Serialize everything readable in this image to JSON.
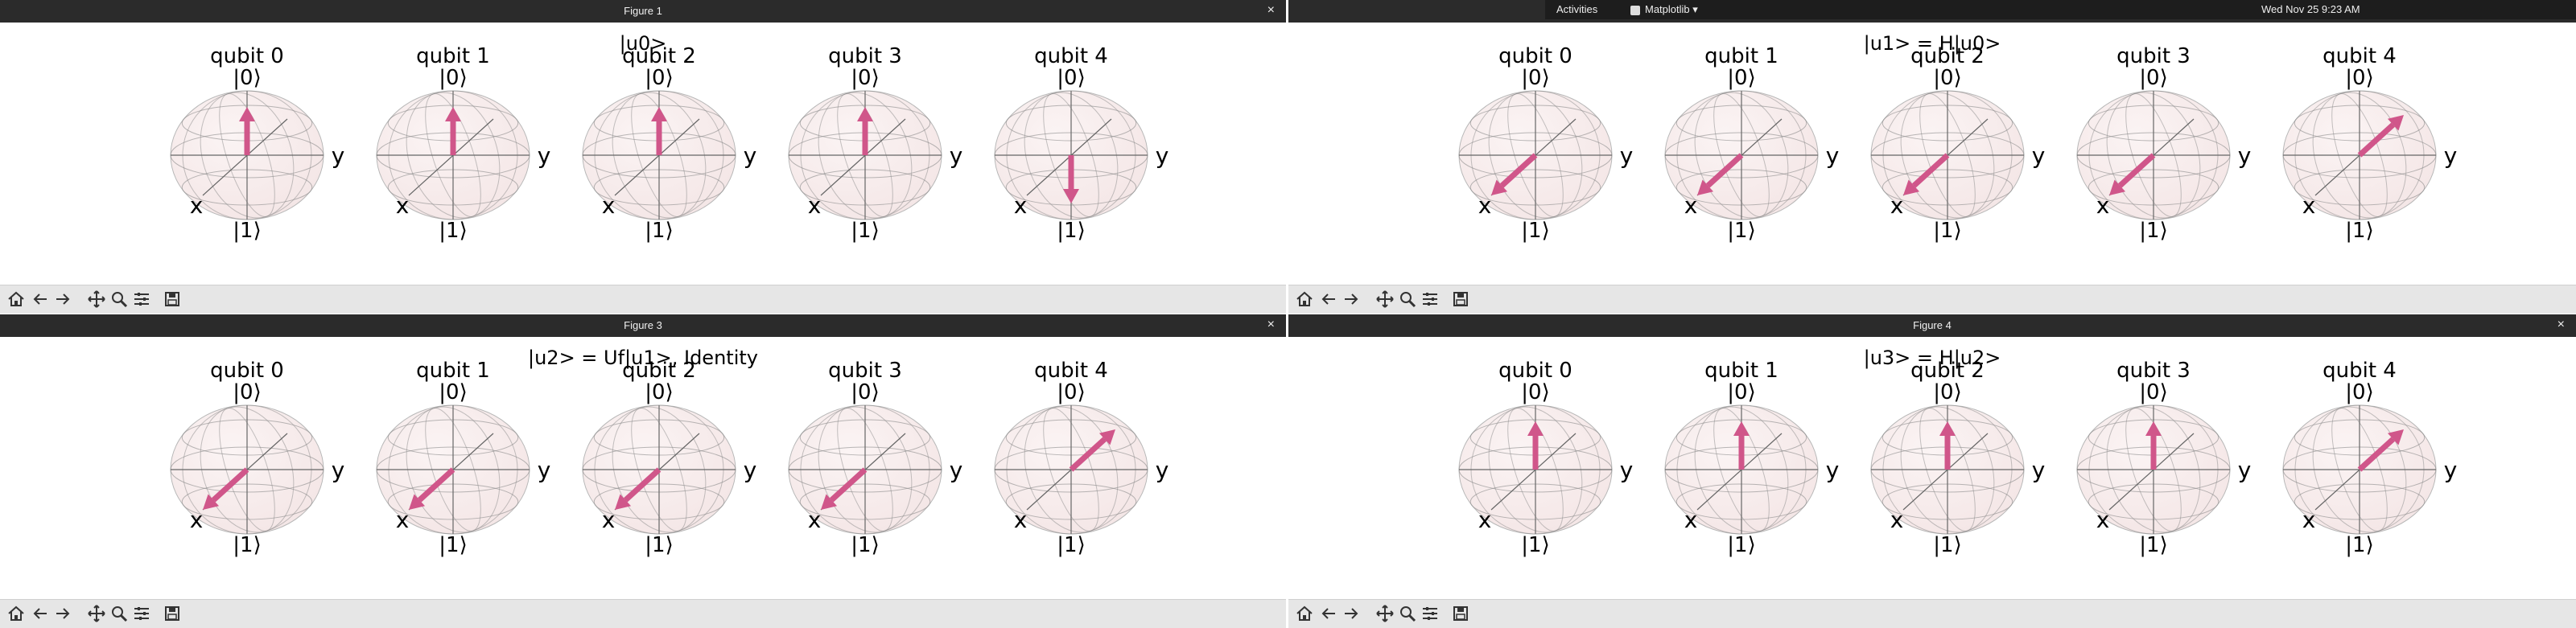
{
  "system_bar": {
    "activities": "Activities",
    "app_name": "Matplotlib",
    "clock": "Wed Nov 25   9:23 AM"
  },
  "windows": [
    {
      "title": "Figure 1",
      "suptitle": "|u0>",
      "close": "×",
      "qubits": [
        {
          "label": "qubit 0",
          "state": "up"
        },
        {
          "label": "qubit 1",
          "state": "up"
        },
        {
          "label": "qubit 2",
          "state": "up"
        },
        {
          "label": "qubit 3",
          "state": "up"
        },
        {
          "label": "qubit 4",
          "state": "down"
        }
      ]
    },
    {
      "title": "",
      "suptitle": "|u1> = H|u0>",
      "close": "×",
      "qubits": [
        {
          "label": "qubit 0",
          "state": "plus_x"
        },
        {
          "label": "qubit 1",
          "state": "plus_x"
        },
        {
          "label": "qubit 2",
          "state": "plus_x"
        },
        {
          "label": "qubit 3",
          "state": "plus_x"
        },
        {
          "label": "qubit 4",
          "state": "minus_x"
        }
      ]
    },
    {
      "title": "Figure 3",
      "suptitle": "|u2> = Uf|u1>, Identity",
      "close": "×",
      "qubits": [
        {
          "label": "qubit 0",
          "state": "plus_x"
        },
        {
          "label": "qubit 1",
          "state": "plus_x"
        },
        {
          "label": "qubit 2",
          "state": "plus_x"
        },
        {
          "label": "qubit 3",
          "state": "plus_x"
        },
        {
          "label": "qubit 4",
          "state": "minus_x"
        }
      ]
    },
    {
      "title": "Figure 4",
      "suptitle": "|u3> = H|u2>",
      "close": "×",
      "qubits": [
        {
          "label": "qubit 0",
          "state": "up"
        },
        {
          "label": "qubit 1",
          "state": "up"
        },
        {
          "label": "qubit 2",
          "state": "up"
        },
        {
          "label": "qubit 3",
          "state": "up"
        },
        {
          "label": "qubit 4",
          "state": "minus_x"
        }
      ]
    }
  ],
  "bloch_labels": {
    "zero": "|0⟩",
    "one": "|1⟩",
    "x": "x",
    "y": "y"
  },
  "colors": {
    "vector": "#d0568a",
    "sphere_fill": "#f4e6e6",
    "wire": "#8a8a8a",
    "titlebar": "#2b2b2b",
    "toolbar": "#e6e6e6"
  },
  "toolbar_icons": [
    "home-icon",
    "back-arrow-icon",
    "forward-arrow-icon",
    "pan-icon",
    "zoom-icon",
    "configure-subplots-icon",
    "save-icon"
  ]
}
